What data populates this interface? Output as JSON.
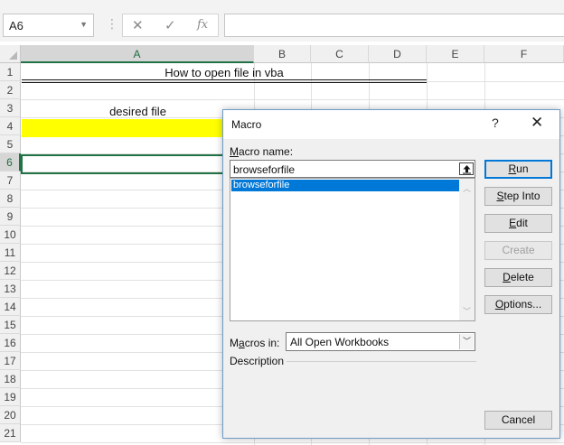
{
  "formula_bar": {
    "name_box": "A6",
    "cancel_icon": "✕",
    "enter_icon": "✓",
    "function_icon": "fx",
    "formula": ""
  },
  "sheet": {
    "columns": [
      "A",
      "B",
      "C",
      "D",
      "E",
      "F"
    ],
    "rows": [
      "1",
      "2",
      "3",
      "4",
      "5",
      "6",
      "7",
      "8",
      "9",
      "10",
      "11",
      "12",
      "13",
      "14",
      "15",
      "16",
      "17",
      "18",
      "19",
      "20",
      "21"
    ],
    "selected_column": "A",
    "selected_row": "6",
    "cells": {
      "A1": "How to open file in vba",
      "A3": "desired file"
    },
    "highlight_color": "#ffff00",
    "selection_color": "#217346"
  },
  "dialog": {
    "title": "Macro",
    "help": "?",
    "close": "✕",
    "macro_name_label_ul": "M",
    "macro_name_label_rest": "acro name:",
    "macro_name_value": "browseforfile",
    "macros": [
      "browseforfile"
    ],
    "macros_in_label_pre": "M",
    "macros_in_label_ul": "a",
    "macros_in_label_rest": "cros in:",
    "macros_in_value": "All Open Workbooks",
    "description_label": "Description",
    "buttons": {
      "run": {
        "ul": "R",
        "rest": "un"
      },
      "step_into": {
        "ul": "S",
        "rest": "tep Into"
      },
      "edit": {
        "ul": "E",
        "rest": "dit"
      },
      "create": {
        "label": "Create"
      },
      "delete": {
        "ul": "D",
        "rest": "elete"
      },
      "options": {
        "ul": "O",
        "rest": "ptions..."
      },
      "cancel": {
        "label": "Cancel"
      }
    },
    "accent_color": "#0078d7"
  }
}
